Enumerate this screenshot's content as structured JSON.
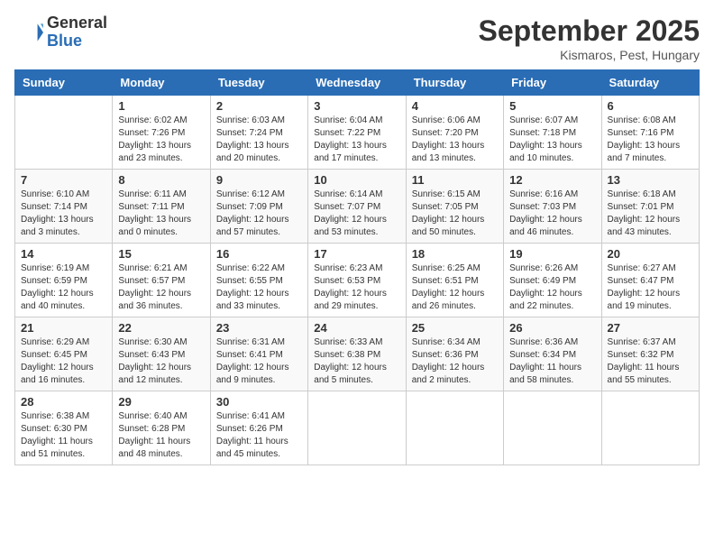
{
  "header": {
    "logo_general": "General",
    "logo_blue": "Blue",
    "month": "September 2025",
    "location": "Kismaros, Pest, Hungary"
  },
  "weekdays": [
    "Sunday",
    "Monday",
    "Tuesday",
    "Wednesday",
    "Thursday",
    "Friday",
    "Saturday"
  ],
  "weeks": [
    [
      {
        "day": "",
        "info": ""
      },
      {
        "day": "1",
        "info": "Sunrise: 6:02 AM\nSunset: 7:26 PM\nDaylight: 13 hours\nand 23 minutes."
      },
      {
        "day": "2",
        "info": "Sunrise: 6:03 AM\nSunset: 7:24 PM\nDaylight: 13 hours\nand 20 minutes."
      },
      {
        "day": "3",
        "info": "Sunrise: 6:04 AM\nSunset: 7:22 PM\nDaylight: 13 hours\nand 17 minutes."
      },
      {
        "day": "4",
        "info": "Sunrise: 6:06 AM\nSunset: 7:20 PM\nDaylight: 13 hours\nand 13 minutes."
      },
      {
        "day": "5",
        "info": "Sunrise: 6:07 AM\nSunset: 7:18 PM\nDaylight: 13 hours\nand 10 minutes."
      },
      {
        "day": "6",
        "info": "Sunrise: 6:08 AM\nSunset: 7:16 PM\nDaylight: 13 hours\nand 7 minutes."
      }
    ],
    [
      {
        "day": "7",
        "info": "Sunrise: 6:10 AM\nSunset: 7:14 PM\nDaylight: 13 hours\nand 3 minutes."
      },
      {
        "day": "8",
        "info": "Sunrise: 6:11 AM\nSunset: 7:11 PM\nDaylight: 13 hours\nand 0 minutes."
      },
      {
        "day": "9",
        "info": "Sunrise: 6:12 AM\nSunset: 7:09 PM\nDaylight: 12 hours\nand 57 minutes."
      },
      {
        "day": "10",
        "info": "Sunrise: 6:14 AM\nSunset: 7:07 PM\nDaylight: 12 hours\nand 53 minutes."
      },
      {
        "day": "11",
        "info": "Sunrise: 6:15 AM\nSunset: 7:05 PM\nDaylight: 12 hours\nand 50 minutes."
      },
      {
        "day": "12",
        "info": "Sunrise: 6:16 AM\nSunset: 7:03 PM\nDaylight: 12 hours\nand 46 minutes."
      },
      {
        "day": "13",
        "info": "Sunrise: 6:18 AM\nSunset: 7:01 PM\nDaylight: 12 hours\nand 43 minutes."
      }
    ],
    [
      {
        "day": "14",
        "info": "Sunrise: 6:19 AM\nSunset: 6:59 PM\nDaylight: 12 hours\nand 40 minutes."
      },
      {
        "day": "15",
        "info": "Sunrise: 6:21 AM\nSunset: 6:57 PM\nDaylight: 12 hours\nand 36 minutes."
      },
      {
        "day": "16",
        "info": "Sunrise: 6:22 AM\nSunset: 6:55 PM\nDaylight: 12 hours\nand 33 minutes."
      },
      {
        "day": "17",
        "info": "Sunrise: 6:23 AM\nSunset: 6:53 PM\nDaylight: 12 hours\nand 29 minutes."
      },
      {
        "day": "18",
        "info": "Sunrise: 6:25 AM\nSunset: 6:51 PM\nDaylight: 12 hours\nand 26 minutes."
      },
      {
        "day": "19",
        "info": "Sunrise: 6:26 AM\nSunset: 6:49 PM\nDaylight: 12 hours\nand 22 minutes."
      },
      {
        "day": "20",
        "info": "Sunrise: 6:27 AM\nSunset: 6:47 PM\nDaylight: 12 hours\nand 19 minutes."
      }
    ],
    [
      {
        "day": "21",
        "info": "Sunrise: 6:29 AM\nSunset: 6:45 PM\nDaylight: 12 hours\nand 16 minutes."
      },
      {
        "day": "22",
        "info": "Sunrise: 6:30 AM\nSunset: 6:43 PM\nDaylight: 12 hours\nand 12 minutes."
      },
      {
        "day": "23",
        "info": "Sunrise: 6:31 AM\nSunset: 6:41 PM\nDaylight: 12 hours\nand 9 minutes."
      },
      {
        "day": "24",
        "info": "Sunrise: 6:33 AM\nSunset: 6:38 PM\nDaylight: 12 hours\nand 5 minutes."
      },
      {
        "day": "25",
        "info": "Sunrise: 6:34 AM\nSunset: 6:36 PM\nDaylight: 12 hours\nand 2 minutes."
      },
      {
        "day": "26",
        "info": "Sunrise: 6:36 AM\nSunset: 6:34 PM\nDaylight: 11 hours\nand 58 minutes."
      },
      {
        "day": "27",
        "info": "Sunrise: 6:37 AM\nSunset: 6:32 PM\nDaylight: 11 hours\nand 55 minutes."
      }
    ],
    [
      {
        "day": "28",
        "info": "Sunrise: 6:38 AM\nSunset: 6:30 PM\nDaylight: 11 hours\nand 51 minutes."
      },
      {
        "day": "29",
        "info": "Sunrise: 6:40 AM\nSunset: 6:28 PM\nDaylight: 11 hours\nand 48 minutes."
      },
      {
        "day": "30",
        "info": "Sunrise: 6:41 AM\nSunset: 6:26 PM\nDaylight: 11 hours\nand 45 minutes."
      },
      {
        "day": "",
        "info": ""
      },
      {
        "day": "",
        "info": ""
      },
      {
        "day": "",
        "info": ""
      },
      {
        "day": "",
        "info": ""
      }
    ]
  ]
}
